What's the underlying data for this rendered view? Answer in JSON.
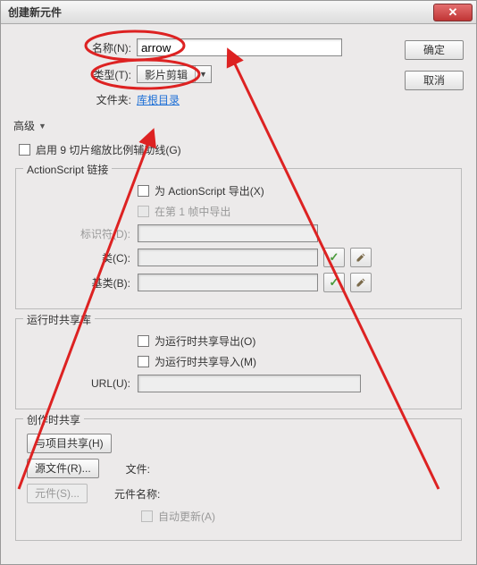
{
  "window": {
    "title": "创建新元件",
    "close_glyph": "✕"
  },
  "buttons": {
    "ok": "确定",
    "cancel": "取消"
  },
  "fields": {
    "name_label": "名称(N):",
    "name_value": "arrow",
    "type_label": "类型(T):",
    "type_value": "影片剪辑",
    "folder_label": "文件夹:",
    "folder_link": "库根目录"
  },
  "advanced": {
    "toggle_label": "高级",
    "triangle": "▼",
    "enable_9slice": "启用 9 切片缩放比例辅助线(G)"
  },
  "as_linkage": {
    "legend": "ActionScript 链接",
    "export_for_as": "为 ActionScript 导出(X)",
    "export_frame1": "在第 1 帧中导出",
    "identifier_label": "标识符(D):",
    "class_label": "类(C):",
    "base_class_label": "基类(B):"
  },
  "runtime_shared": {
    "legend": "运行时共享库",
    "export_for_runtime": "为运行时共享导出(O)",
    "import_for_runtime": "为运行时共享导入(M)",
    "url_label": "URL(U):"
  },
  "authoring_shared": {
    "legend": "创作时共享",
    "share_with_project": "与项目共享(H)",
    "source_file_btn": "源文件(R)...",
    "symbol_btn": "元件(S)...",
    "file_label": "文件:",
    "symbol_name_label": "元件名称:",
    "auto_update": "自动更新(A)"
  },
  "icons": {
    "check": "✓"
  }
}
